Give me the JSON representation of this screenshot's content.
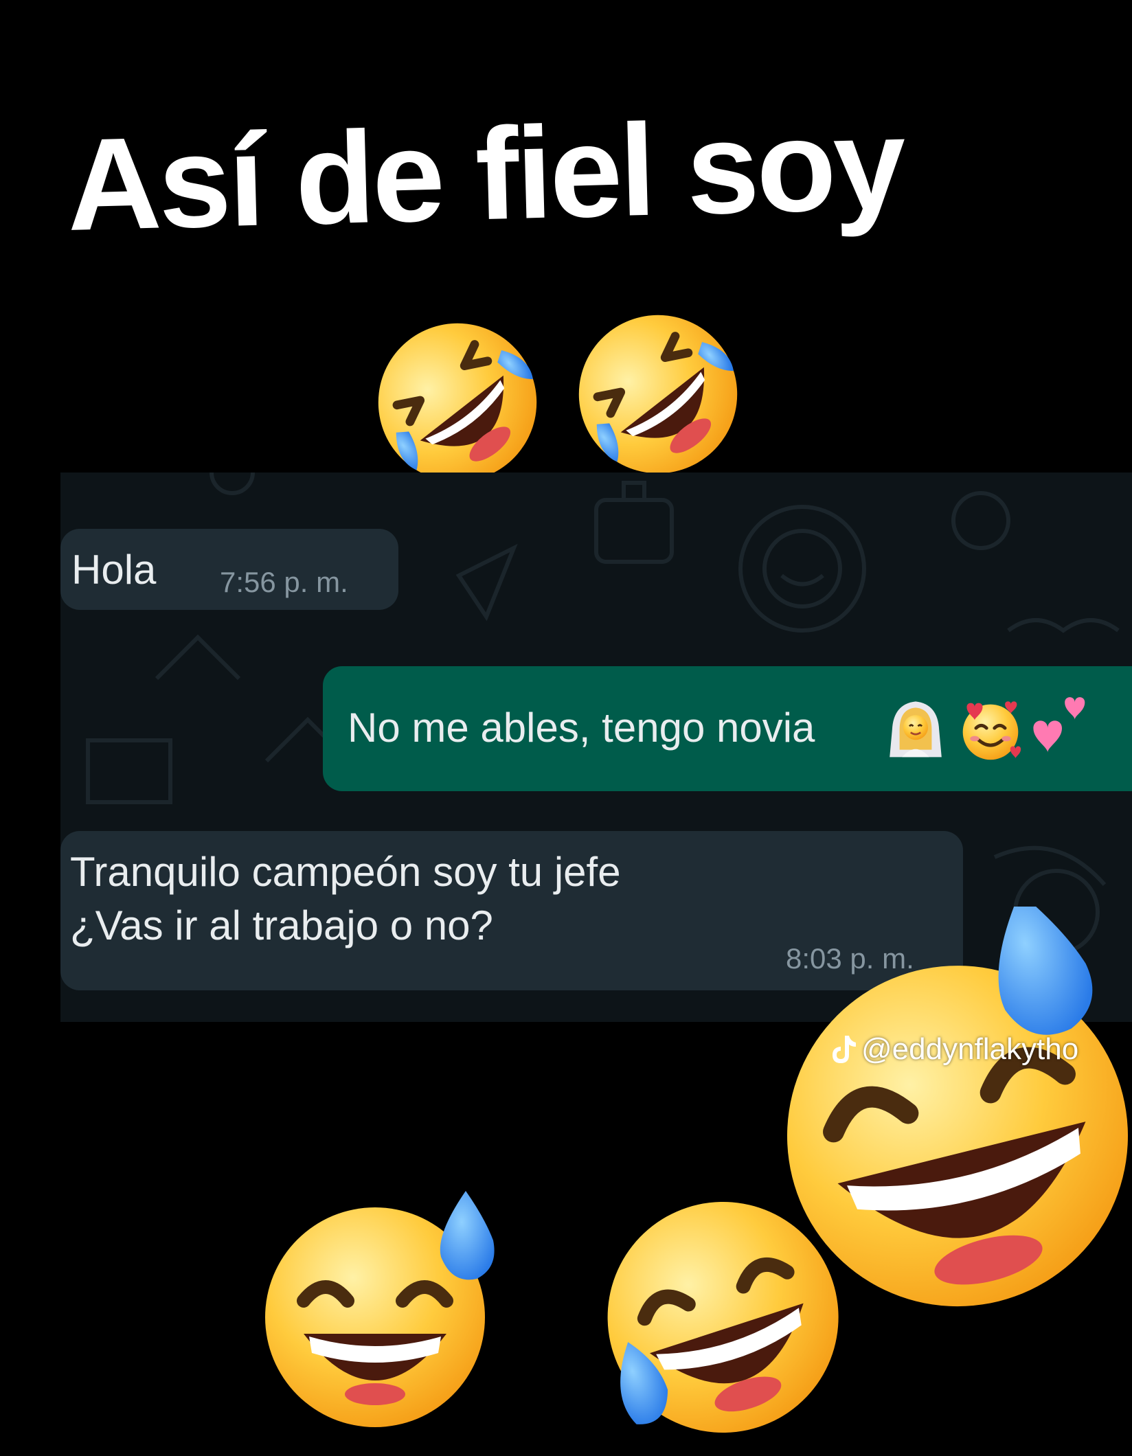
{
  "headline": "Así de fiel soy",
  "chat": {
    "messages": [
      {
        "direction": "incoming",
        "text": "Hola",
        "time": "7:56 p. m."
      },
      {
        "direction": "outgoing",
        "text": "No me ables, tengo novia"
      },
      {
        "direction": "incoming",
        "lines": [
          "Tranquilo campeón soy tu jefe",
          "¿Vas ir al trabajo o no?"
        ],
        "time": "8:03 p. m."
      }
    ]
  },
  "watermark": {
    "handle": "@eddynflakytho",
    "icon": "tiktok-icon"
  },
  "emoji_decorations": {
    "top_pair": [
      "rolling-on-floor-laughing-icon",
      "rolling-on-floor-laughing-icon"
    ],
    "message_emoji": [
      "woman-with-veil-icon",
      "smiling-face-with-hearts-icon",
      "two-hearts-icon"
    ],
    "bottom_group": [
      "grinning-face-with-sweat-icon",
      "face-with-tears-of-joy-icon",
      "grinning-face-with-sweat-icon"
    ]
  },
  "colors": {
    "background": "#000000",
    "chat_panel": "#0d1418",
    "incoming_bubble": "#1f2c34",
    "outgoing_bubble": "#005c4b",
    "message_text": "#e9edef",
    "timestamp": "#8696a0",
    "emoji_yellow": "#ffc83d",
    "tear_blue": "#3d8ef0"
  }
}
